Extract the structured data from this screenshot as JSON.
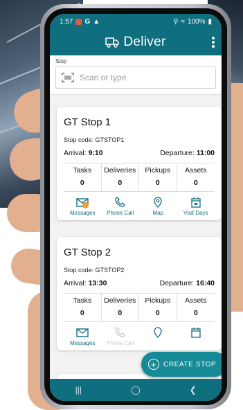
{
  "status_bar": {
    "time": "1:57",
    "battery": "100%"
  },
  "app_bar": {
    "title": "Deliver",
    "truck_icon": "truck-icon",
    "menu_icon": "kebab-menu-icon"
  },
  "search": {
    "label": "Stop",
    "placeholder": "Scan or type",
    "icon": "barcode-scan-icon"
  },
  "stats_labels": [
    "Tasks",
    "Deliveries",
    "Pickups",
    "Assets"
  ],
  "actions": {
    "messages": "Messages",
    "phone": "Phone Call",
    "map": "Map",
    "visit": "Visit Days"
  },
  "stops": [
    {
      "name": "GT Stop 1",
      "code_label": "Stop code:",
      "code": "GTSTOP1",
      "arrival_label": "Arrival:",
      "arrival": "9:10",
      "departure_label": "Departure:",
      "departure": "11:00",
      "tasks": "0",
      "deliveries": "0",
      "pickups": "0",
      "assets": "0"
    },
    {
      "name": "GT Stop 2",
      "code_label": "Stop code:",
      "code": "GTSTOP2",
      "arrival_label": "Arrival:",
      "arrival": "13:30",
      "departure_label": "Departure:",
      "departure": "16:40",
      "tasks": "0",
      "deliveries": "0",
      "pickups": "0",
      "assets": "0"
    }
  ],
  "fab": {
    "label": "CREATE STOP",
    "icon": "plus-circle-icon"
  },
  "colors": {
    "primary": "#0f6f7f",
    "fab": "#168a96",
    "badge": "#f0a030"
  }
}
